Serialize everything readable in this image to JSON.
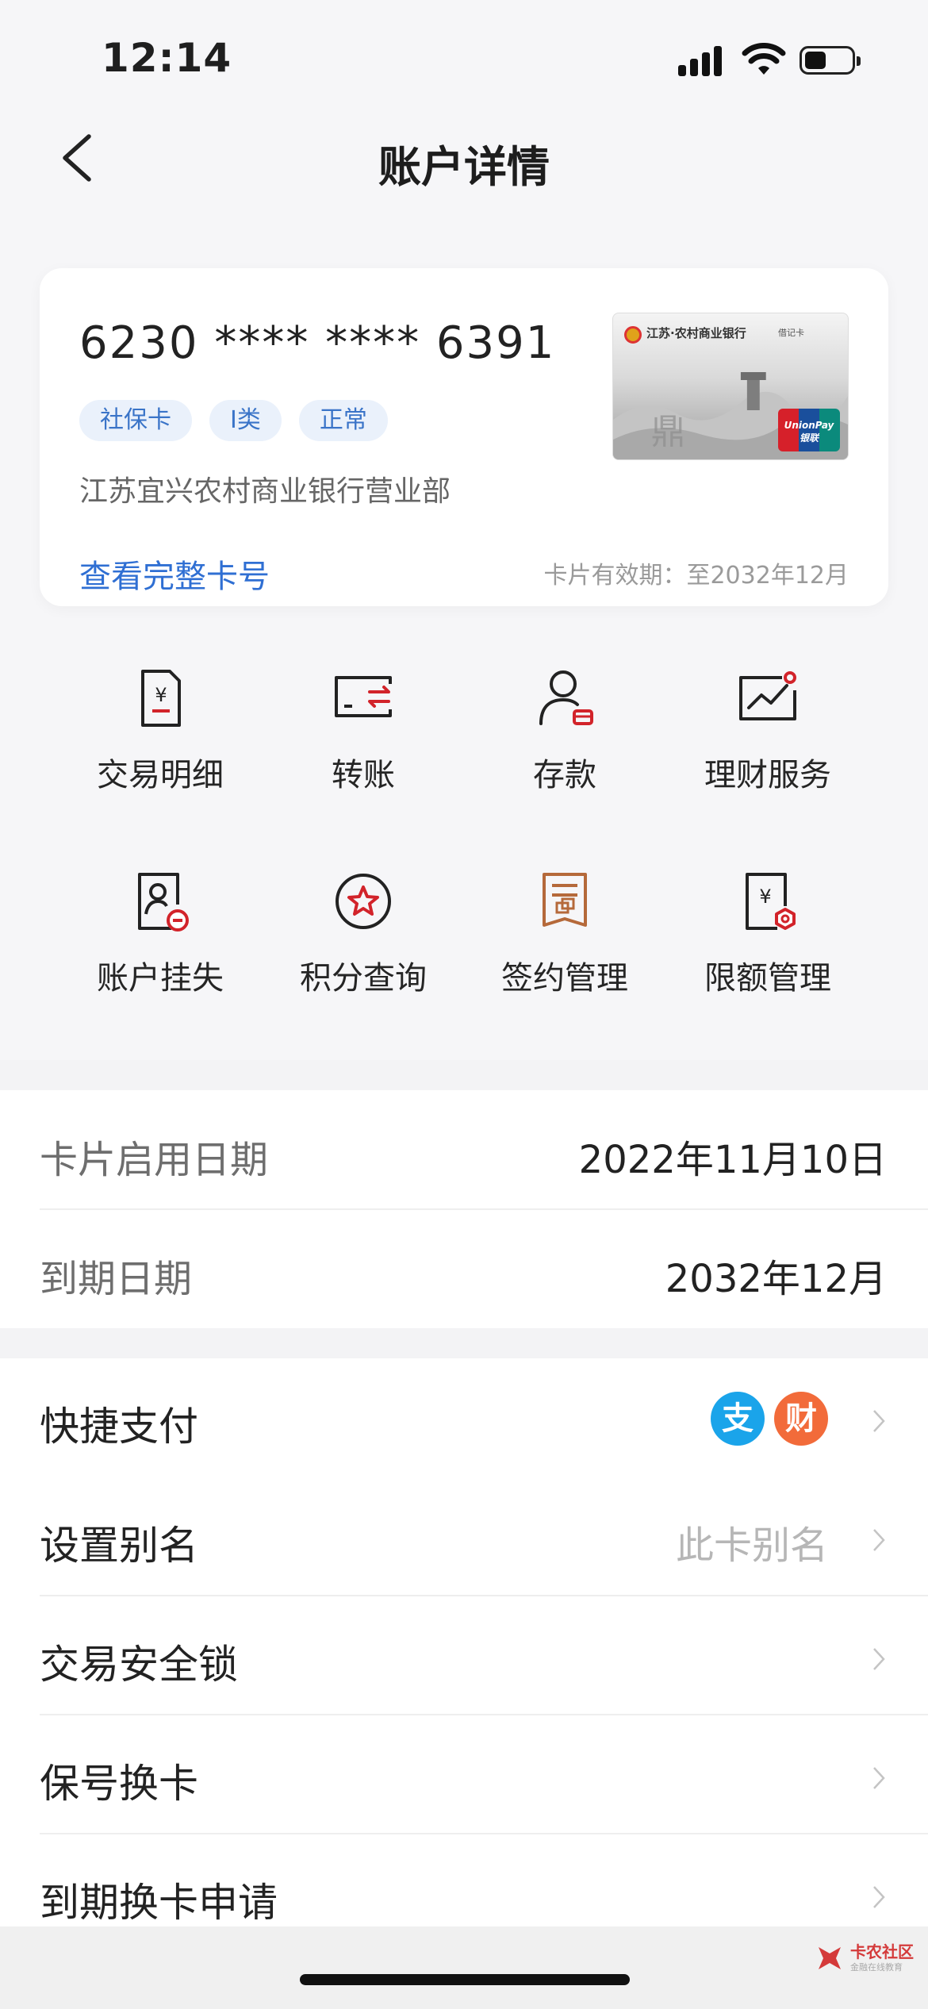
{
  "status_bar": {
    "time": "12:14"
  },
  "nav": {
    "title": "账户详情"
  },
  "card": {
    "number": "6230 **** **** 6391",
    "tags": [
      "社保卡",
      "I类",
      "正常"
    ],
    "branch": "江苏宜兴农村商业银行营业部",
    "view_full_label": "查看完整卡号",
    "expiry_text": "卡片有效期：至2032年12月",
    "image": {
      "bank_name": "江苏·农村商业银行",
      "card_kind": "借记卡",
      "network": "UnionPay 银联"
    }
  },
  "services": [
    {
      "label": "交易明细",
      "icon": "transaction-detail-icon"
    },
    {
      "label": "转账",
      "icon": "transfer-icon"
    },
    {
      "label": "存款",
      "icon": "deposit-icon"
    },
    {
      "label": "理财服务",
      "icon": "wealth-service-icon"
    },
    {
      "label": "账户挂失",
      "icon": "report-loss-icon"
    },
    {
      "label": "积分查询",
      "icon": "points-query-icon"
    },
    {
      "label": "签约管理",
      "icon": "contract-management-icon"
    },
    {
      "label": "限额管理",
      "icon": "limit-management-icon"
    }
  ],
  "dates": {
    "activation_label": "卡片启用日期",
    "activation_value": "2022年11月10日",
    "expiry_label": "到期日期",
    "expiry_value": "2032年12月"
  },
  "menu": {
    "quick_pay": {
      "label": "快捷支付",
      "badges": [
        "支",
        "财"
      ]
    },
    "alias": {
      "label": "设置别名",
      "hint": "此卡别名"
    },
    "security_lock": {
      "label": "交易安全锁"
    },
    "keep_number": {
      "label": "保号换卡"
    },
    "expiry_renewal": {
      "label": "到期换卡申请"
    }
  },
  "watermark": {
    "title": "卡农社区",
    "subtitle": "金融在线教育"
  },
  "colors": {
    "accent_blue": "#2f6fd3",
    "icon_red": "#d2232a",
    "alipay_blue": "#1aa4ea",
    "wealth_orange": "#f26b3a"
  }
}
